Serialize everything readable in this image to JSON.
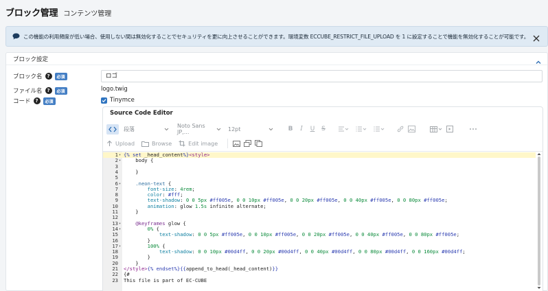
{
  "header": {
    "title": "ブロック管理",
    "subtitle": "コンテンツ管理"
  },
  "alert": {
    "text": "この機能の利用頻度が低い場合、使用しない間は無効化することでセキュリティを更に向上させることができます。環境変数 ECCUBE_RESTRICT_FILE_UPLOAD を 1 に設定することで機能を無効化することが可能です。"
  },
  "card": {
    "title": "ブロック設定"
  },
  "form": {
    "block_name_label": "ブロック名",
    "file_name_label": "ファイル名",
    "code_label": "コード",
    "required_badge": "必須",
    "help_mark": "?",
    "block_name_value": "ロゴ",
    "file_name_value": "logo.twig",
    "tinymce_label": "Tinymce"
  },
  "editor": {
    "title": "Source Code Editor",
    "toolbar": {
      "block_format": "段落",
      "font_family": "Noto Sans JP,...",
      "font_size": "12pt",
      "upload_label": "Upload",
      "browse_label": "Browse",
      "edit_image_label": "Edit image"
    },
    "lines": [
      {
        "n": "1",
        "fold": true,
        "text": "{% set _head_content%}<style>"
      },
      {
        "n": "2",
        "fold": true,
        "text": "    body {"
      },
      {
        "n": "3",
        "fold": false,
        "text": ""
      },
      {
        "n": "4",
        "fold": false,
        "text": "    }"
      },
      {
        "n": "5",
        "fold": false,
        "text": ""
      },
      {
        "n": "6",
        "fold": true,
        "text": "    .neon-text {"
      },
      {
        "n": "7",
        "fold": false,
        "text": "        font-size: 4rem;"
      },
      {
        "n": "8",
        "fold": false,
        "text": "        color: #fff;"
      },
      {
        "n": "9",
        "fold": false,
        "text": "        text-shadow: 0 0 5px #ff005e, 0 0 10px #ff005e, 0 0 20px #ff005e, 0 0 40px #ff005e, 0 0 80px #ff005e;"
      },
      {
        "n": "10",
        "fold": false,
        "text": "        animation: glow 1.5s infinite alternate;"
      },
      {
        "n": "11",
        "fold": false,
        "text": "    }"
      },
      {
        "n": "12",
        "fold": false,
        "text": ""
      },
      {
        "n": "13",
        "fold": true,
        "text": "    @keyframes glow {"
      },
      {
        "n": "14",
        "fold": true,
        "text": "        0% {"
      },
      {
        "n": "15",
        "fold": false,
        "text": "            text-shadow: 0 0 5px #ff005e, 0 0 10px #ff005e, 0 0 20px #ff005e, 0 0 40px #ff005e, 0 0 80px #ff005e;"
      },
      {
        "n": "16",
        "fold": false,
        "text": "        }"
      },
      {
        "n": "17",
        "fold": true,
        "text": "        100% {"
      },
      {
        "n": "18",
        "fold": false,
        "text": "            text-shadow: 0 0 10px #00d4ff, 0 0 20px #00d4ff, 0 0 40px #00d4ff, 0 0 80px #00d4ff, 0 0 160px #00d4ff;"
      },
      {
        "n": "19",
        "fold": false,
        "text": "        }"
      },
      {
        "n": "20",
        "fold": false,
        "text": "    }"
      },
      {
        "n": "21",
        "fold": false,
        "text": "</style>{% endset%}{{append_to_head(_head_content)}}"
      },
      {
        "n": "22",
        "fold": false,
        "text": "{#"
      },
      {
        "n": "23",
        "fold": false,
        "text": "This file is part of EC-CUBE"
      }
    ]
  },
  "colors": {
    "accent": "#437ec4",
    "alert_bg": "#dfeaf4",
    "active_line": "#fff7c9"
  }
}
